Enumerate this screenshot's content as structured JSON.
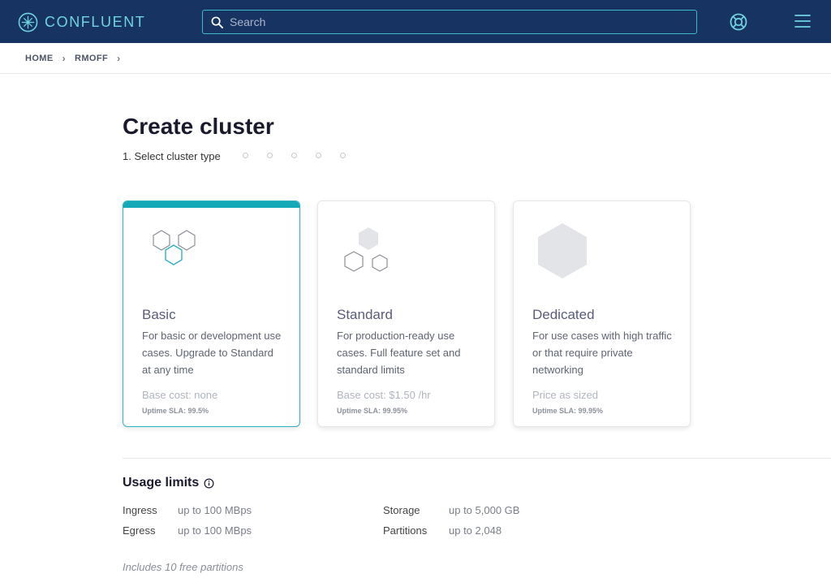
{
  "header": {
    "brand": "CONFLUENT",
    "search_placeholder": "Search",
    "colors": {
      "bar": "#173361",
      "accent": "#3fb9cc"
    },
    "icons": [
      "confluent-logo-icon",
      "search-icon",
      "help-lifebuoy-icon",
      "hamburger-menu-icon"
    ]
  },
  "breadcrumb": {
    "items": [
      "HOME",
      "RMOFF"
    ],
    "separator": "›"
  },
  "page": {
    "title": "Create cluster",
    "step_label": "1. Select cluster type",
    "remaining_steps": 5
  },
  "cluster_types": [
    {
      "name": "Basic",
      "description": "For basic or development use cases. Upgrade to Standard at any time",
      "cost": "Base cost: none",
      "sla": "Uptime SLA: 99.5%",
      "selected": true
    },
    {
      "name": "Standard",
      "description": "For production-ready use cases. Full feature set and standard limits",
      "cost": "Base cost: $1.50 /hr",
      "sla": "Uptime SLA: 99.95%",
      "selected": false
    },
    {
      "name": "Dedicated",
      "description": "For use cases with high traffic or that require private networking",
      "cost": "Price as sized",
      "sla": "Uptime SLA: 99.95%",
      "selected": false
    }
  ],
  "usage": {
    "title": "Usage limits",
    "limits": [
      {
        "label": "Ingress",
        "value": "up to 100 MBps"
      },
      {
        "label": "Egress",
        "value": "up to 100 MBps"
      },
      {
        "label": "Storage",
        "value": "up to 5,000 GB"
      },
      {
        "label": "Partitions",
        "value": "up to 2,048"
      }
    ],
    "note": "Includes 10 free partitions"
  },
  "colors": {
    "selected_accent": "#13a9b6",
    "hex_fill": "#e3e4e8"
  }
}
